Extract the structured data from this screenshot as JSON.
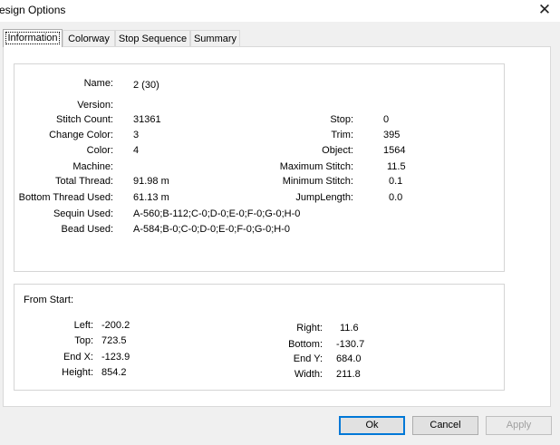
{
  "window": {
    "title": "esign Options",
    "close_glyph": "✕"
  },
  "tabs": [
    "Information",
    "Colorway",
    "Stop Sequence",
    "Summary"
  ],
  "info": {
    "name_label": "Name:",
    "name_value": "2 (30)",
    "version_label": "Version:",
    "stitch_count_label": "Stitch Count:",
    "stitch_count_value": "31361",
    "change_color_label": "Change Color:",
    "change_color_value": "3",
    "color_label": "Color:",
    "color_value": "4",
    "machine_label": "Machine:",
    "total_thread_label": "Total Thread:",
    "total_thread_value": "91.98 m",
    "bottom_thread_label": "Bottom Thread Used:",
    "bottom_thread_value": "61.13 m",
    "sequin_label": "Sequin Used:",
    "sequin_value": "A-560;B-112;C-0;D-0;E-0;F-0;G-0;H-0",
    "bead_label": "Bead Used:",
    "bead_value": "A-584;B-0;C-0;D-0;E-0;F-0;G-0;H-0",
    "stop_label": "Stop:",
    "stop_value": "0",
    "trim_label": "Trim:",
    "trim_value": "395",
    "object_label": "Object:",
    "object_value": "1564",
    "max_stitch_label": "Maximum Stitch:",
    "max_stitch_value": "11.5",
    "min_stitch_label": "Minimum Stitch:",
    "min_stitch_value": "0.1",
    "jump_length_label": "JumpLength:",
    "jump_length_value": "0.0"
  },
  "from_start": {
    "heading": "From Start:",
    "left_label": "Left:",
    "left_value": "-200.2",
    "top_label": "Top:",
    "top_value": "723.5",
    "end_x_label": "End X:",
    "end_x_value": "-123.9",
    "height_label": "Height:",
    "height_value": "854.2",
    "right_label": "Right:",
    "right_value": "11.6",
    "bottom_label": "Bottom:",
    "bottom_value": "-130.7",
    "end_y_label": "End Y:",
    "end_y_value": "684.0",
    "width_label": "Width:",
    "width_value": "211.8"
  },
  "buttons": {
    "ok": "Ok",
    "cancel": "Cancel",
    "apply": "Apply"
  },
  "colors": {
    "accent": "#0078d7",
    "dialog_bg": "#f0f0f0",
    "disabled_text": "#a0a0a0"
  }
}
